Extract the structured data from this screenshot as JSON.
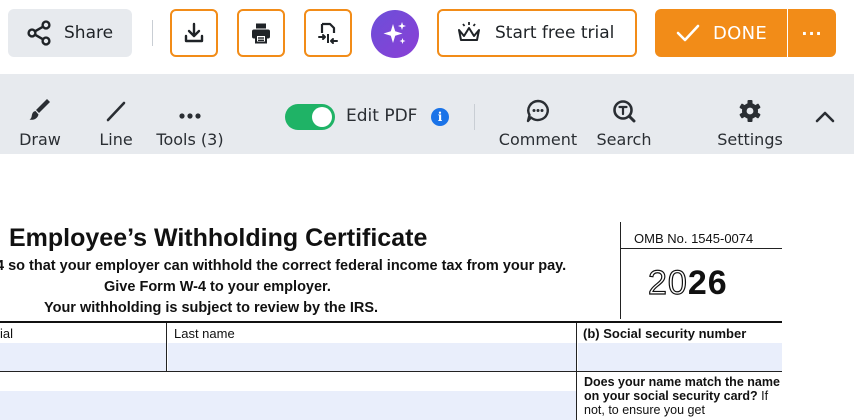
{
  "topbar": {
    "share_label": "Share",
    "trial_label": "Start free trial",
    "done_label": "DONE",
    "more_label": "···",
    "accent_color": "#f28c18"
  },
  "toolbar": {
    "draw_label": "Draw",
    "line_label": "Line",
    "tools_label": "Tools (3)",
    "edit_pdf_label": "Edit PDF",
    "edit_pdf_enabled": true,
    "info_label": "i",
    "comment_label": "Comment",
    "search_label": "Search",
    "settings_label": "Settings",
    "icons": [
      "brush-icon",
      "line-icon",
      "more-dots-icon",
      "info-icon",
      "comment-icon",
      "search-icon",
      "gear-icon",
      "chevron-up-icon"
    ]
  },
  "document": {
    "title": "Employee’s Withholding Certificate",
    "subtitle_lines": [
      "4 so that your employer can withhold the correct federal income tax from your pay.",
      "Give Form W-4 to your employer.",
      "Your withholding is subject to review by the IRS."
    ],
    "omb": "OMB No. 1545-0074",
    "year_light": "20",
    "year_bold": "26",
    "col_initial_label": "ial",
    "col_lastname_label": "Last name",
    "col_ssn_label": "(b)   Social security number",
    "note_bold1": "Does your name match the name on your social security card?",
    "note_rest": " If not, to ensure you get"
  }
}
